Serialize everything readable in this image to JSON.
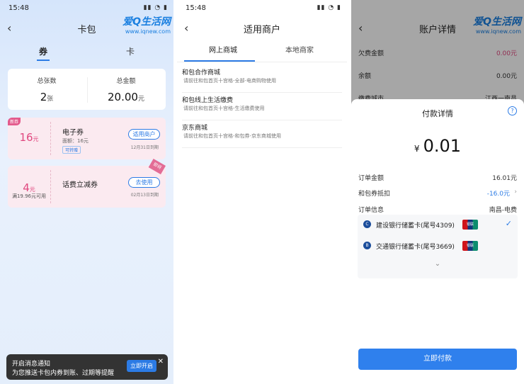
{
  "panel1": {
    "status_time": "15:48",
    "title": "卡包",
    "logo_text": "爱Q生活网",
    "logo_url": "www.iqnew.com",
    "tabs": [
      "券",
      "卡"
    ],
    "summary": {
      "count_label": "总张数",
      "count_value": "2",
      "count_unit": "张",
      "amount_label": "总金额",
      "amount_value": "20.00",
      "amount_unit": "元"
    },
    "coupons": [
      {
        "badge": "新券",
        "amount": "16",
        "unit": "元",
        "name": "电子券",
        "sub": "面额：16元",
        "tag": "可转赠",
        "button": "适用商户",
        "expire": "12月31日到期"
      },
      {
        "amount": "4",
        "unit": "元",
        "condition": "满19.96元可用",
        "name": "话费立减券",
        "button": "去使用",
        "expire": "02月13日到期",
        "corner": "即将"
      }
    ],
    "notification": {
      "line1": "开启消息通知",
      "line2": "为您推送卡包内券到账、过期等提醒",
      "button": "立即开启",
      "close": "✕"
    }
  },
  "panel2": {
    "status_time": "15:48",
    "title": "适用商户",
    "tabs": [
      "网上商城",
      "本地商家"
    ],
    "merchants": [
      {
        "name": "和包合作商城",
        "desc": "请前往和包首页十宫格-全部-电商购物使用"
      },
      {
        "name": "和包线上生活缴费",
        "desc": "请前往和包首页十宫格-生活缴费使用"
      },
      {
        "name": "京东商城",
        "desc": "请前往和包首页十宫格-和包券-京东商城使用"
      }
    ]
  },
  "panel3": {
    "status_time": "15:49",
    "title": "账户详情",
    "logo_text": "爱Q生活网",
    "logo_url": "www.iqnew.com",
    "account_rows": [
      {
        "k": "欠费金额",
        "v": "0.00元"
      },
      {
        "k": "余额",
        "v": "0.00元"
      },
      {
        "k": "缴费城市",
        "v": "江西一南昌"
      }
    ],
    "sheet": {
      "title": "付款详情",
      "help": "?",
      "currency": "¥",
      "amount": "0.01",
      "order_amount_label": "订单金额",
      "order_amount_value": "16.01元",
      "coupon_label": "和包券抵扣",
      "coupon_value": "-16.0元",
      "order_info_label": "订单信息",
      "order_info_value": "南昌-电费",
      "cards": [
        {
          "name": "建设银行储蓄卡(尾号4309)",
          "icon": "C"
        },
        {
          "name": "交通银行储蓄卡(尾号3669)",
          "icon": "B"
        }
      ],
      "unionpay": "银联",
      "pay_button": "立即付款"
    }
  },
  "colors": {
    "accent": "#2c7be5",
    "coupon_pink": "#e0487f"
  }
}
